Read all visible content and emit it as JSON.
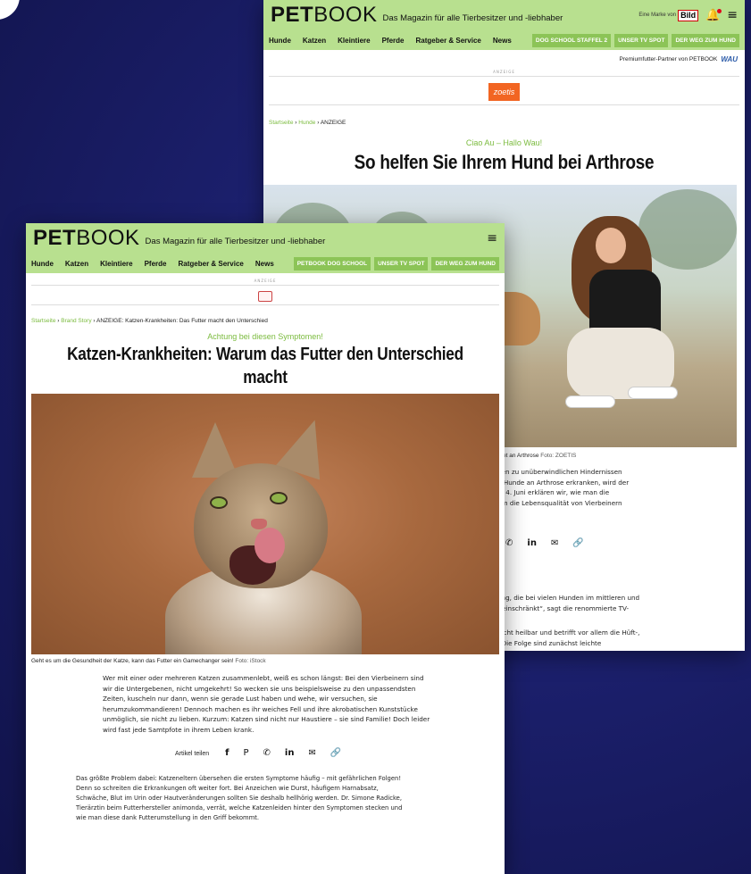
{
  "brand": {
    "logo_bold": "PET",
    "logo_light": "BOOK",
    "tagline": "Das Magazin für alle Tierbesitzer und -liebhaber"
  },
  "header_icons": {
    "bild_small": "Eine Marke von",
    "bild_mark": "Bild",
    "bell_icon": "bell-icon",
    "menu_icon": "hamburger-menu-icon"
  },
  "nav": {
    "items": [
      "Hunde",
      "Katzen",
      "Kleintiere",
      "Pferde",
      "Ratgeber & Service",
      "News"
    ],
    "back_pills": [
      "DOG SCHOOL STAFFEL 2",
      "UNSER TV SPOT",
      "DER WEG ZUM HUND"
    ],
    "front_pills": [
      "PETBOOK DOG SCHOOL",
      "UNSER TV SPOT",
      "DER WEG ZUM HUND"
    ]
  },
  "colors": {
    "header_green": "#b8e08f",
    "pill_green": "#8cc457",
    "kicker_green": "#7bbb3e",
    "zoetis_orange": "#f26522",
    "background": "#1b1f6b"
  },
  "back_article": {
    "partner_text": "Premiumfutter-Partner von PETBOOK",
    "partner_logo": "WAU",
    "ad_label": "ANZEIGE",
    "sponsor_logo": "zoetis",
    "breadcrumb": {
      "home": "Startseite",
      "sep": " › ",
      "section": "Hunde",
      "current": "ANZEIGE"
    },
    "kicker": "Ciao Au – Hallo Wau!",
    "title": "So helfen Sie Ihrem Hund bei Arthrose",
    "caption": "et an Arthrose",
    "caption_source": "Foto: ZOETIS",
    "intro_lines": [
      "pen zu unüberwindlichen Hindernissen",
      "n Hunde an Arthrose erkranken, wird der",
      "m 4. Juni erklären wir, wie man die",
      "um die Lebensqualität von Vierbeinern"
    ],
    "body_lines_1": [
      "ung, die bei vielen Hunden im mittleren und",
      "t einschränkt“, sagt die renommierte TV-"
    ],
    "body_lines_2": [
      "nicht heilbar und betrifft vor allem die Hüft-,",
      ". Die Folge sind zunächst leichte"
    ]
  },
  "front_article": {
    "ad_label": "ANZEIGE",
    "breadcrumb": {
      "home": "Startseite",
      "sep": " › ",
      "section": "Brand Story",
      "current": "ANZEIGE: Katzen-Krankheiten: Das Futter macht den Unterschied"
    },
    "kicker": "Achtung bei diesen Symptomen!",
    "title": "Katzen-Krankheiten: Warum das Futter den Unterschied macht",
    "caption": "Geht es um die Gesundheit der Katze, kann das Futter ein Gamechanger sein!",
    "caption_source": "Foto: iStock",
    "intro_bold": "Wer mit einer oder mehreren Katzen zusammenlebt, weiß es schon längst: Bei den Vierbeinern sind wir die Untergebenen, nicht umgekehrt! So wecken sie uns beispielsweise zu den unpassendsten Zeiten, kuscheln nur dann, wenn sie gerade Lust haben und wehe, wir versuchen, sie herumzukommandieren! Dennoch machen es ihr weiches Fell und ihre akrobatischen Kunststücke unmöglich, sie nicht zu lieben. Kurzum: Katzen sind nicht nur Haustiere – sie sind Familie! Doch leider wird fast jede Samtpfote in ihrem Leben krank.",
    "share_label": "Artikel teilen",
    "body": "Das größte Problem dabei: Katzeneltern übersehen die ersten Symptome häufig – mit gefährlichen Folgen! Denn so schreiten die Erkrankungen oft weiter fort. Bei Anzeichen wie Durst, häufigem Harnabsatz, Schwäche, Blut im Urin oder Hautveränderungen sollten Sie deshalb hellhörig werden. Dr. Simone Radicke, Tierärztin beim Futterhersteller animonda, verrät, welche Katzenleiden hinter den Symptomen stecken und wie man diese dank Futterumstellung in den Griff bekommt."
  },
  "share_icons": {
    "facebook": "f",
    "pinterest": "P",
    "whatsapp": "✆",
    "linkedin": "in",
    "email": "✉",
    "link": "🔗"
  }
}
